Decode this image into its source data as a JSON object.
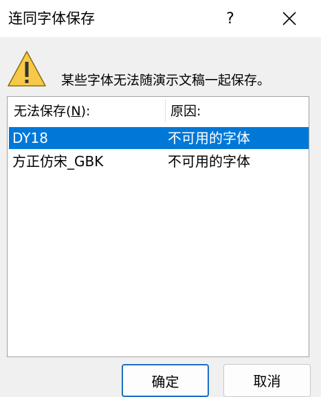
{
  "dialog": {
    "title": "连同字体保存",
    "help_label": "?",
    "message": "某些字体无法随演示文稿一起保存。"
  },
  "list": {
    "columns": {
      "name_prefix": "无法保存(",
      "name_hotkey": "N",
      "name_suffix": "):",
      "reason": "原因:"
    },
    "rows": [
      {
        "font": "DY18",
        "reason": "不可用的字体",
        "selected": true
      },
      {
        "font": "方正仿宋_GBK",
        "reason": "不可用的字体",
        "selected": false
      }
    ]
  },
  "buttons": {
    "ok": "确定",
    "cancel": "取消"
  },
  "colors": {
    "selection": "#0078d7",
    "warning_fill": "#f7c948",
    "default_button_border": "#1a6dc4"
  },
  "icons": {
    "warning": "warning-triangle-icon",
    "close": "close-x-icon"
  }
}
